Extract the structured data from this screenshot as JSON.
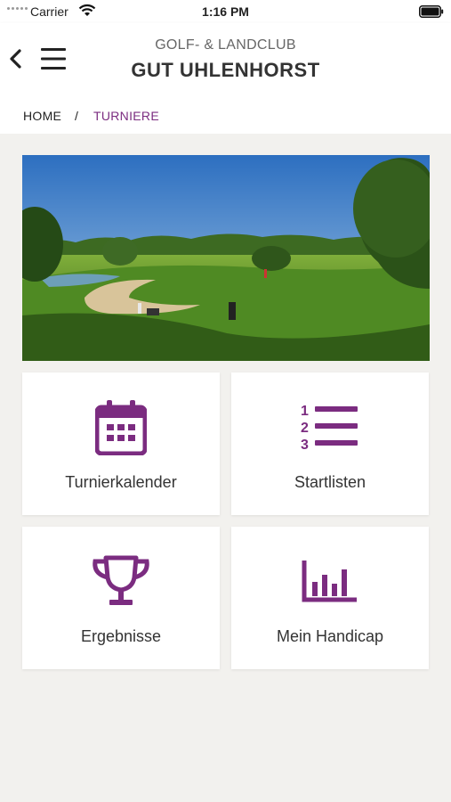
{
  "status_bar": {
    "carrier": "Carrier",
    "time": "1:16 PM"
  },
  "header": {
    "subtitle": "GOLF- & LANDCLUB",
    "title": "GUT UHLENHORST"
  },
  "breadcrumb": {
    "home": "HOME",
    "separator": "/",
    "current": "TURNIERE"
  },
  "tiles": [
    {
      "label": "Turnierkalender",
      "icon": "calendar-icon"
    },
    {
      "label": "Startlisten",
      "icon": "numbered-list-icon"
    },
    {
      "label": "Ergebnisse",
      "icon": "trophy-icon"
    },
    {
      "label": "Mein Handicap",
      "icon": "bar-chart-icon"
    }
  ],
  "colors": {
    "accent": "#7b2c80",
    "background": "#f2f1ee",
    "card": "#ffffff"
  }
}
